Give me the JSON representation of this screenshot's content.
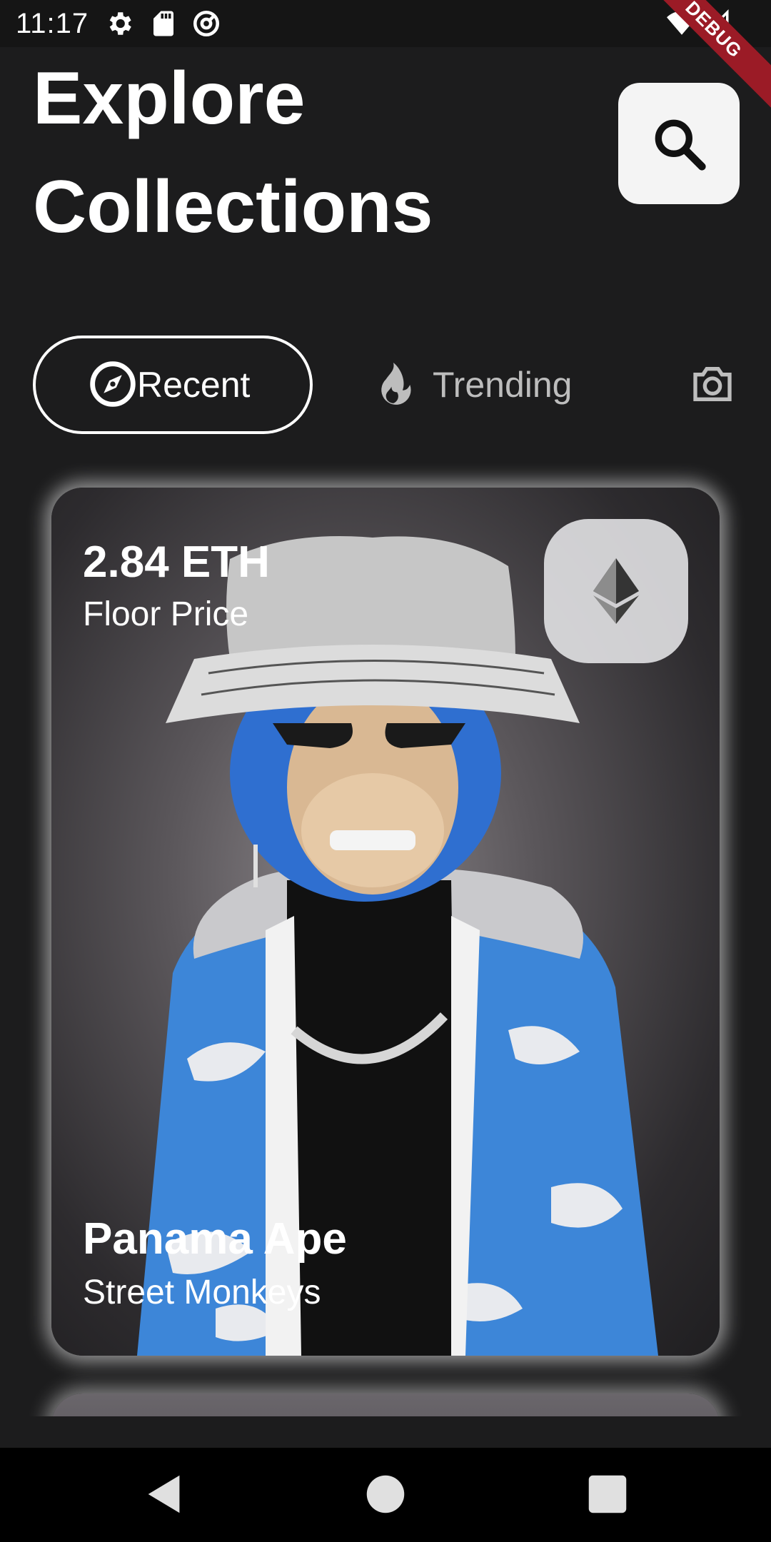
{
  "status_bar": {
    "time": "11:17",
    "icons": [
      "settings-icon",
      "sd-card-icon",
      "at-sign-icon",
      "wifi-icon",
      "signal-icon",
      "battery-icon"
    ],
    "debug_label": "DEBUG"
  },
  "header": {
    "title_line1": "Explore",
    "title_line2": "Collections",
    "search_icon": "search-icon"
  },
  "tabs": [
    {
      "label": "Recent",
      "icon": "compass-icon",
      "selected": true
    },
    {
      "label": "Trending",
      "icon": "flame-icon",
      "selected": false
    },
    {
      "label": "",
      "icon": "camera-icon",
      "selected": false
    }
  ],
  "featured": {
    "price": "2.84 ETH",
    "price_label": "Floor Price",
    "currency_icon": "ethereum-icon",
    "name": "Panama Ape",
    "collection": "Street Monkeys"
  },
  "nav_bar": {
    "buttons": [
      "back-icon",
      "home-icon",
      "recents-icon"
    ]
  },
  "colors": {
    "background": "#1c1c1d",
    "accent_debug": "#9b1b26",
    "search_bg": "#f4f4f4"
  }
}
